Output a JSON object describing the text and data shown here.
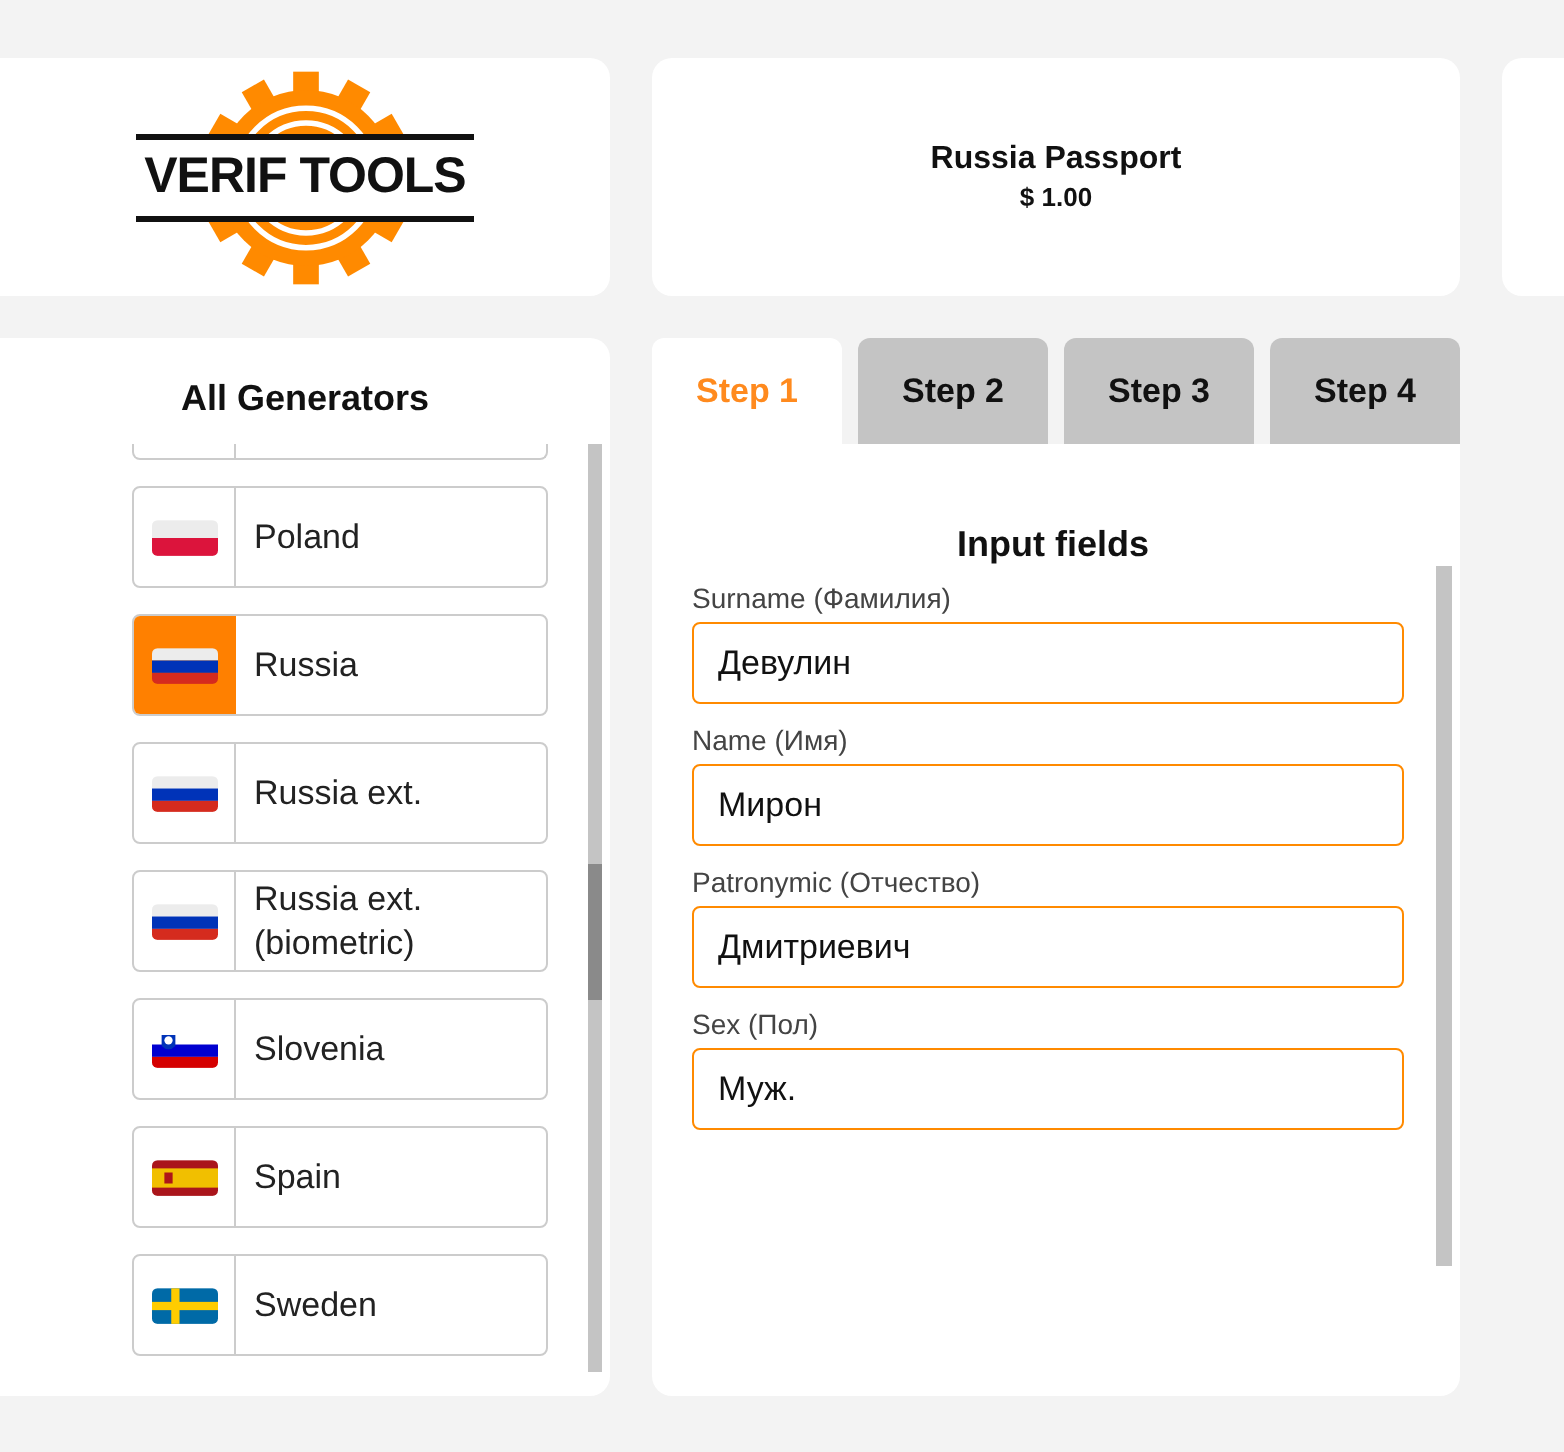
{
  "logo": {
    "text": "VERIF TOOLS"
  },
  "product": {
    "title": "Russia Passport",
    "price": "$ 1.00"
  },
  "generators": {
    "title": "All Generators",
    "items": [
      {
        "name": "Poland",
        "kind": "poland",
        "selected": false
      },
      {
        "name": "Russia",
        "kind": "russia",
        "selected": true
      },
      {
        "name": "Russia ext.",
        "kind": "russia",
        "selected": false
      },
      {
        "name": "Russia ext. (biometric)",
        "kind": "russia",
        "selected": false
      },
      {
        "name": "Slovenia",
        "kind": "slovenia",
        "selected": false
      },
      {
        "name": "Spain",
        "kind": "spain",
        "selected": false
      },
      {
        "name": "Sweden",
        "kind": "sweden",
        "selected": false
      }
    ]
  },
  "tabs": [
    {
      "label": "Step 1",
      "selected": true
    },
    {
      "label": "Step 2",
      "selected": false
    },
    {
      "label": "Step 3",
      "selected": false
    },
    {
      "label": "Step 4",
      "selected": false
    }
  ],
  "form": {
    "title": "Input fields",
    "fields": [
      {
        "label": "Surname (Фамилия)",
        "value": "Девулин"
      },
      {
        "label": "Name (Имя)",
        "value": "Мирон"
      },
      {
        "label": "Patronymic (Отчество)",
        "value": "Дмитриевич"
      },
      {
        "label": "Sex (Пол)",
        "value": "Муж."
      }
    ]
  }
}
